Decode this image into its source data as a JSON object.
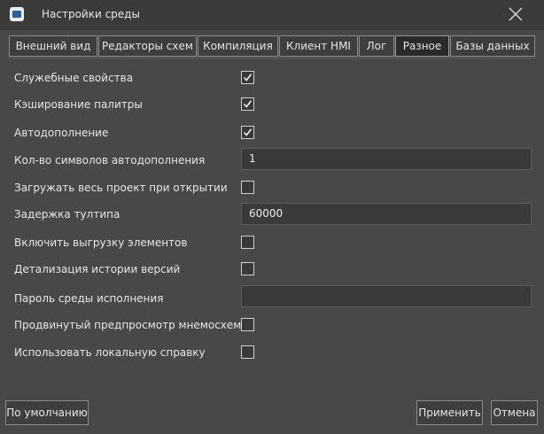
{
  "window": {
    "title": "Настройки среды",
    "app_icon": "app-logo-icon",
    "close_icon": "close-icon"
  },
  "tabs": [
    {
      "label": "Внешний вид",
      "active": false
    },
    {
      "label": "Редакторы схем",
      "active": false
    },
    {
      "label": "Компиляция",
      "active": false
    },
    {
      "label": "Клиент HMI",
      "active": false
    },
    {
      "label": "Лог",
      "active": false
    },
    {
      "label": "Разное",
      "active": true
    },
    {
      "label": "Базы данных",
      "active": false
    }
  ],
  "settings": [
    {
      "label": "Служебные свойства",
      "type": "checkbox",
      "checked": true
    },
    {
      "label": "Кэширование палитры",
      "type": "checkbox",
      "checked": true
    },
    {
      "label": "Автодополнение",
      "type": "checkbox",
      "checked": true
    },
    {
      "label": "Кол-во символов автодополнения",
      "type": "text",
      "value": "1"
    },
    {
      "label": "Загружать весь проект при открытии",
      "type": "checkbox",
      "checked": false
    },
    {
      "label": "Задержка тултипа",
      "type": "text",
      "value": "60000"
    },
    {
      "label": "Включить выгрузку элементов",
      "type": "checkbox",
      "checked": false
    },
    {
      "label": "Детализация истории версий",
      "type": "checkbox",
      "checked": false
    },
    {
      "label": "Пароль среды исполнения",
      "type": "text",
      "value": ""
    },
    {
      "label": "Продвинутый предпросмотр мнемосхемы",
      "type": "checkbox",
      "checked": false
    },
    {
      "label": "Использовать локальную справку",
      "type": "checkbox",
      "checked": false
    }
  ],
  "buttons": {
    "defaults": "По умолчанию",
    "apply": "Применить",
    "cancel": "Отмена"
  },
  "colors": {
    "background": "#4a4846",
    "titlebar": "#3c3b39",
    "active_tab": "#2b2a29",
    "input_bg": "#3b3a38"
  }
}
